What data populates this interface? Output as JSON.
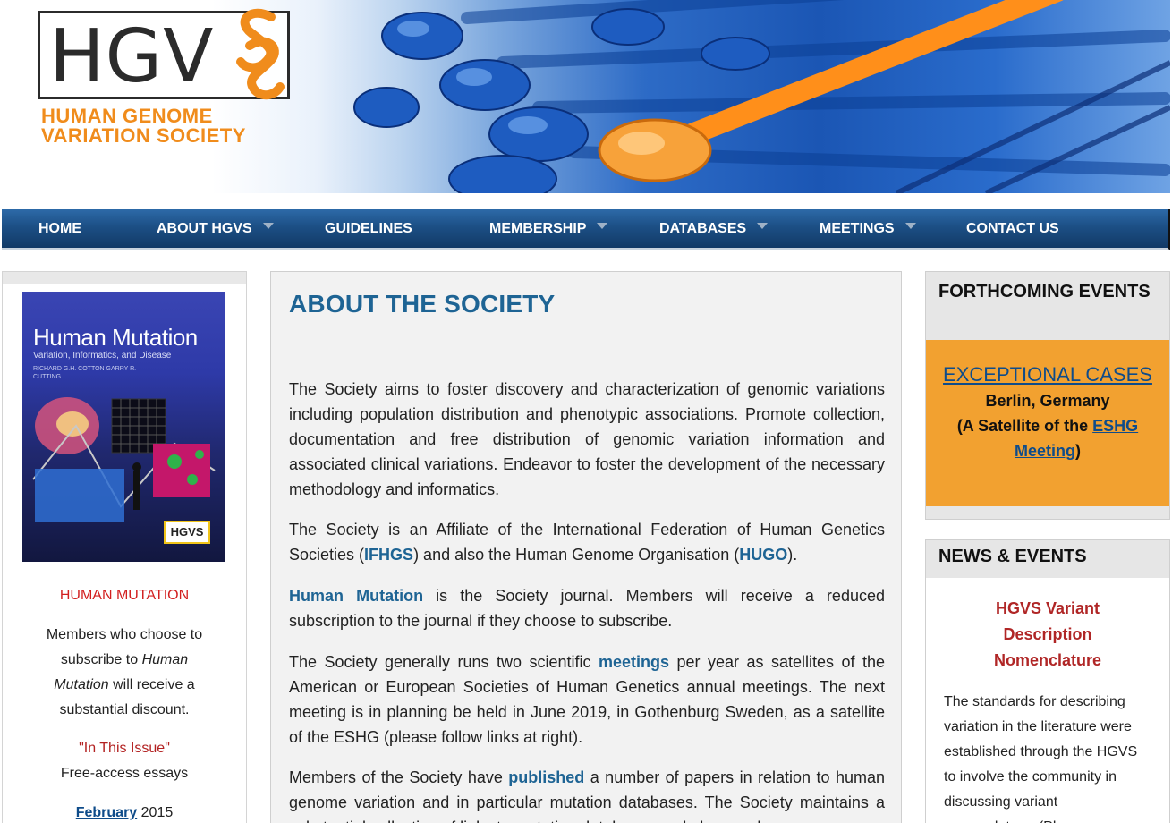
{
  "header": {
    "logo_letters": "HGV",
    "logo_line1": "HUMAN GENOME",
    "logo_line2": "VARIATION SOCIETY"
  },
  "nav": {
    "items": [
      {
        "label": "HOME",
        "dropdown": false
      },
      {
        "label": "ABOUT HGVS",
        "dropdown": true
      },
      {
        "label": "GUIDELINES",
        "dropdown": false
      },
      {
        "label": "MEMBERSHIP",
        "dropdown": true
      },
      {
        "label": "DATABASES",
        "dropdown": true
      },
      {
        "label": "MEETINGS",
        "dropdown": true
      },
      {
        "label": "CONTACT US",
        "dropdown": false
      }
    ]
  },
  "left_sidebar": {
    "cover": {
      "title": "Human Mutation",
      "subtitle": "Variation, Informatics, and Disease",
      "editors": "RICHARD G.H. COTTON  GARRY R. CUTTING",
      "badge": "HGVS"
    },
    "heading": "HUMAN MUTATION",
    "body_before": "Members who choose to subscribe to ",
    "body_em": "Human Mutation",
    "body_after": " will receive a substantial discount.",
    "issue_quote_open": "\"",
    "issue_label": "In This Issue",
    "issue_quote_close": "\"",
    "issue_sub": "Free-access essays",
    "issue_month": "February",
    "issue_year": " 2015"
  },
  "main": {
    "title": "ABOUT THE SOCIETY",
    "p1": "The Society aims to foster discovery and characterization of genomic variations including population distribution and phenotypic associations. Promote collection, documentation and free distribution of genomic variation information and associated clinical variations. Endeavor to foster the development of the necessary methodology and informatics.",
    "p2_a": "The Society is an Affiliate of the International Federation of Human Genetics Societies (",
    "p2_link1": "IFHGS",
    "p2_b": ") and also the Human Genome Organisation (",
    "p2_link2": "HUGO",
    "p2_c": ").",
    "p3_link": "Human Mutation",
    "p3_text": " is the Society journal. Members will receive a reduced subscription to the journal if they choose to subscribe.",
    "p4_a": "The Society generally runs two scientific ",
    "p4_link": "meetings",
    "p4_b": " per year as satellites of the American or European Societies of Human Genetics annual meetings. The next meeting is in planning be held in June 2019, in Gothenburg Sweden, as a satellite of the ESHG (please follow links at right).",
    "p5_a": "Members of the Society have ",
    "p5_link": "published",
    "p5_b": " a number of papers in relation to human genome variation and in particular mutation databases. The Society maintains a substantial collection of links to mutation databases and also good"
  },
  "right_sidebar": {
    "events_heading": "FORTHCOMING EVENTS",
    "event_title": "EXCEPTIONAL CASES",
    "event_location": "Berlin, Germany",
    "event_satellite_pre": "(A Satellite of the ",
    "event_satellite_link": "ESHG Meeting",
    "event_satellite_post": ")",
    "news_heading": "NEWS & EVENTS",
    "news_item_title": "HGVS Variant Description Nomenclature",
    "news_item_body": "The standards for describing variation in the literature were established through the HGVS to involve the community in discussing variant nomenclature. (Please"
  },
  "colors": {
    "nav_bg": "#1c4f85",
    "title_blue": "#1e6494",
    "link_blue": "#0f4c8a",
    "logo_orange": "#f08c1c",
    "event_orange": "#f2a130",
    "heading_red": "#d21f1f",
    "news_red": "#b02626"
  }
}
